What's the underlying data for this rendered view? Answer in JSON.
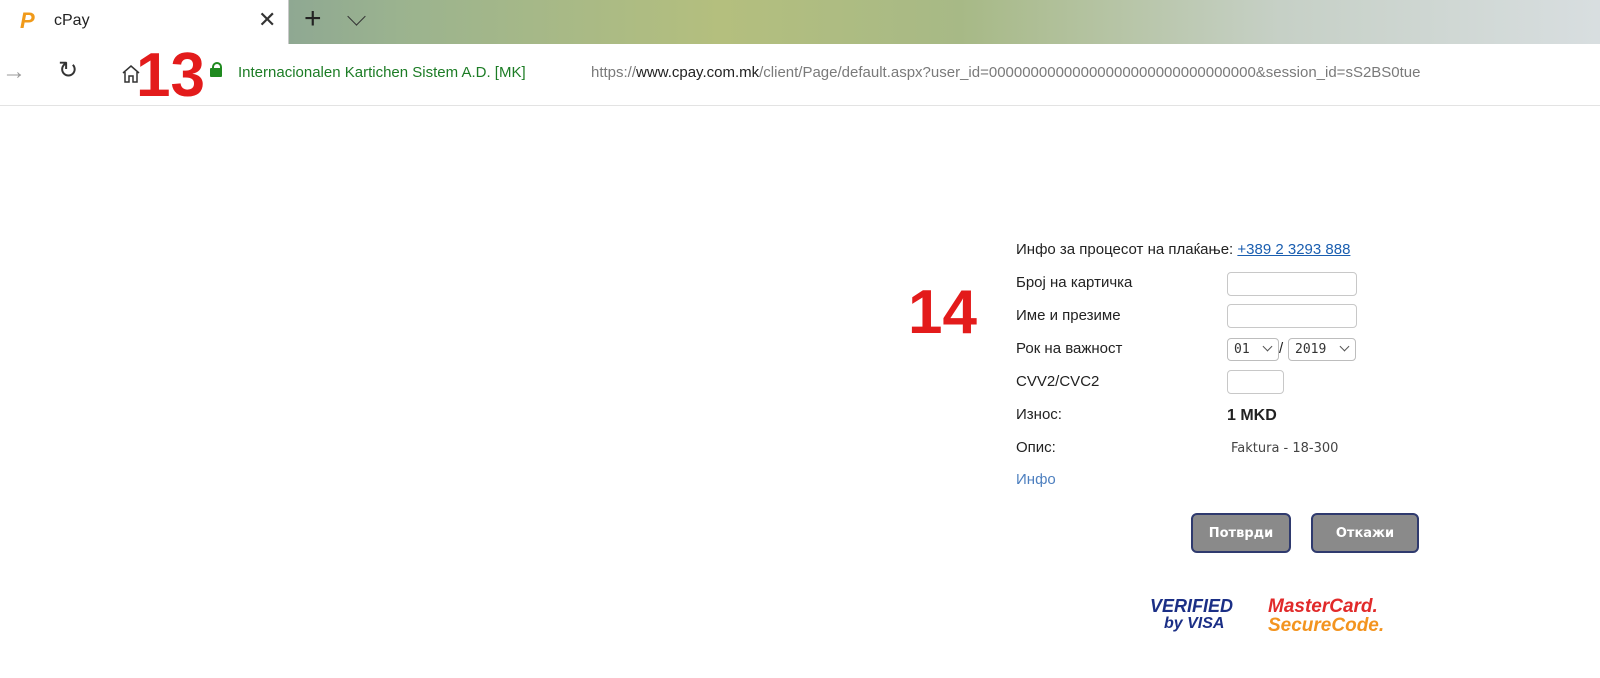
{
  "browser": {
    "tab": {
      "title": "cPay",
      "favicon_letter": "P"
    },
    "controls": {
      "close_glyph": "✕",
      "new_tab_glyph": "+",
      "forward_glyph": "→",
      "refresh_glyph": "↻"
    },
    "address": {
      "cert_label": "Internacionalen Kartichen Sistem A.D. [MK]",
      "url_prefix": "https://",
      "url_host": "www.cpay.com.mk",
      "url_path": "/client/Page/default.aspx?user_id=00000000000000000000000000000000&session_id=sS2BS0tue"
    }
  },
  "annotations": {
    "a13": "13",
    "a14": "14"
  },
  "form": {
    "info_text": "Инфо за процесот на плаќање:",
    "info_phone": "+389 2 3293 888",
    "card_number_label": "Број на картичка",
    "name_label": "Име и презиме",
    "expiry_label": "Рок на важност",
    "expiry_month": "01",
    "expiry_sep": "/",
    "expiry_year": "2019",
    "cvv_label": "CVV2/CVC2",
    "amount_label": "Износ:",
    "amount_value": "1 MKD",
    "description_label": "Опис:",
    "description_value": "Faktura - 18-300",
    "info_link": "Инфо",
    "confirm_button": "Потврди",
    "cancel_button": "Откажи"
  },
  "badges": {
    "visa_line1": "VERIFIED",
    "visa_line2": "by VISA",
    "mastercard_line1": "MasterCard.",
    "mastercard_line2": "SecureCode."
  },
  "colors": {
    "annotation": "#e31b1b",
    "cert_green": "#1c7c25",
    "link_blue": "#1a5eb0",
    "button_gray": "#8a8a8a",
    "button_border": "#2f3a6e"
  },
  "icons": {
    "favicon": "paypal-p-icon",
    "tab_close": "close-icon",
    "new_tab": "plus-icon",
    "tab_list": "chevron-down-icon",
    "forward": "forward-arrow-icon",
    "refresh": "refresh-icon",
    "home": "home-icon",
    "lock": "lock-icon"
  }
}
